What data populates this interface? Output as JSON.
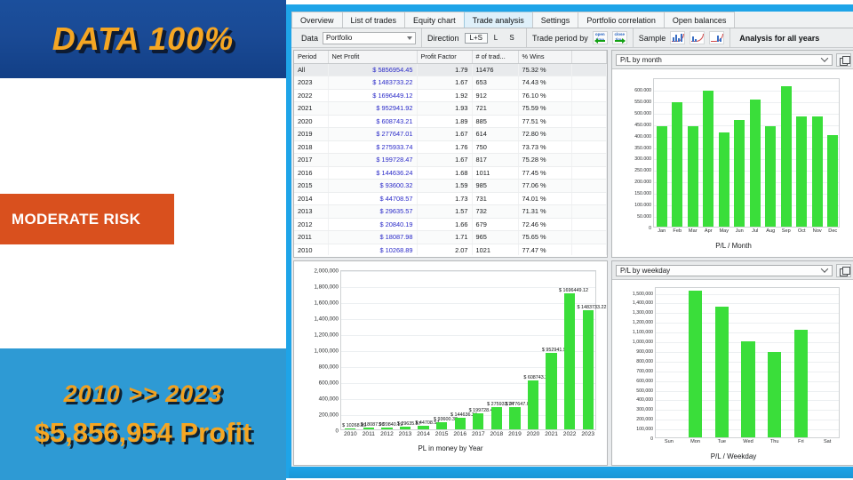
{
  "promo": {
    "headline": "DATA 100%",
    "risk_badge": "MODERATE RISK",
    "years_range": "2010 >> 2023",
    "profit_line": "$5,856,954 Profit",
    "colors": {
      "band_top": "#1b4f9c",
      "band_bottom": "#2e9ad4",
      "accent": "#f5a623",
      "risk": "#d9501e"
    }
  },
  "app": {
    "accent": "#1ea4e8",
    "tabs": [
      {
        "label": "Overview",
        "active": false
      },
      {
        "label": "List of trades",
        "active": false
      },
      {
        "label": "Equity chart",
        "active": false
      },
      {
        "label": "Trade analysis",
        "active": true
      },
      {
        "label": "Settings",
        "active": false
      },
      {
        "label": "Portfolio correlation",
        "active": false
      },
      {
        "label": "Open balances",
        "active": false
      }
    ],
    "toolbar": {
      "data_label": "Data",
      "data_value": "Portfolio",
      "direction_label": "Direction",
      "direction_options": [
        "L+S",
        "L",
        "S"
      ],
      "direction_selected": "L+S",
      "trade_period_label": "Trade period by",
      "trade_period_icons": [
        "open-time",
        "close-time"
      ],
      "open_time_text": "open time",
      "close_time_text": "close time",
      "sample_label": "Sample",
      "sample_icons": [
        "sample-all-icon",
        "sample-in-icon",
        "sample-out-icon"
      ],
      "analysis_title": "Analysis for all years"
    }
  },
  "table": {
    "columns": [
      "Period",
      "Net Profit",
      "Profit Factor",
      "# of trad...",
      "% Wins"
    ],
    "rows": [
      {
        "period": "All",
        "net_profit": "$ 5856954.45",
        "profit_factor": "1.79",
        "trades": "11476",
        "wins": "75.32 %",
        "highlight": true
      },
      {
        "period": "2023",
        "net_profit": "$ 1483733.22",
        "profit_factor": "1.67",
        "trades": "653",
        "wins": "74.43 %"
      },
      {
        "period": "2022",
        "net_profit": "$ 1696449.12",
        "profit_factor": "1.92",
        "trades": "912",
        "wins": "76.10 %"
      },
      {
        "period": "2021",
        "net_profit": "$ 952941.92",
        "profit_factor": "1.93",
        "trades": "721",
        "wins": "75.59 %"
      },
      {
        "period": "2020",
        "net_profit": "$ 608743.21",
        "profit_factor": "1.89",
        "trades": "885",
        "wins": "77.51 %"
      },
      {
        "period": "2019",
        "net_profit": "$ 277647.01",
        "profit_factor": "1.67",
        "trades": "614",
        "wins": "72.80 %"
      },
      {
        "period": "2018",
        "net_profit": "$ 275933.74",
        "profit_factor": "1.76",
        "trades": "750",
        "wins": "73.73 %"
      },
      {
        "period": "2017",
        "net_profit": "$ 199728.47",
        "profit_factor": "1.67",
        "trades": "817",
        "wins": "75.28 %"
      },
      {
        "period": "2016",
        "net_profit": "$ 144636.24",
        "profit_factor": "1.68",
        "trades": "1011",
        "wins": "77.45 %"
      },
      {
        "period": "2015",
        "net_profit": "$ 93600.32",
        "profit_factor": "1.59",
        "trades": "985",
        "wins": "77.06 %"
      },
      {
        "period": "2014",
        "net_profit": "$ 44708.57",
        "profit_factor": "1.73",
        "trades": "731",
        "wins": "74.01 %"
      },
      {
        "period": "2013",
        "net_profit": "$ 29635.57",
        "profit_factor": "1.57",
        "trades": "732",
        "wins": "71.31 %"
      },
      {
        "period": "2012",
        "net_profit": "$ 20840.19",
        "profit_factor": "1.66",
        "trades": "679",
        "wins": "72.46 %"
      },
      {
        "period": "2011",
        "net_profit": "$ 18087.98",
        "profit_factor": "1.71",
        "trades": "965",
        "wins": "75.65 %"
      },
      {
        "period": "2010",
        "net_profit": "$ 10268.89",
        "profit_factor": "2.07",
        "trades": "1021",
        "wins": "77.47 %"
      }
    ]
  },
  "panels": {
    "month_select": "P/L by month",
    "weekday_select": "P/L by weekday",
    "popout_icon": "popout-icon"
  },
  "chart_data": [
    {
      "id": "month",
      "type": "bar",
      "title": "",
      "xlabel": "P/L / Month",
      "ylabel": "",
      "categories": [
        "Jan",
        "Feb",
        "Mar",
        "Apr",
        "May",
        "Jun",
        "Jul",
        "Aug",
        "Sep",
        "Oct",
        "Nov",
        "Dec"
      ],
      "values": [
        438000,
        543000,
        438000,
        592000,
        410000,
        464000,
        553000,
        437000,
        613000,
        479000,
        478000,
        397000
      ],
      "ylim": [
        0,
        650000
      ],
      "yticks": [
        0,
        50000,
        100000,
        150000,
        200000,
        250000,
        300000,
        350000,
        400000,
        450000,
        500000,
        550000,
        600000
      ],
      "ytick_labels": [
        "0",
        "50.000",
        "100.000",
        "150.000",
        "200.000",
        "250.000",
        "300.000",
        "350.000",
        "400.000",
        "450.000",
        "500.000",
        "550.000",
        "600.000"
      ],
      "grid": true,
      "bar_color": "#3ade3a"
    },
    {
      "id": "year",
      "type": "bar",
      "title": "",
      "xlabel": "PL in money by Year",
      "ylabel": "",
      "categories": [
        "2010",
        "2011",
        "2012",
        "2013",
        "2014",
        "2015",
        "2016",
        "2017",
        "2018",
        "2019",
        "2020",
        "2021",
        "2022",
        "2023"
      ],
      "values": [
        10268.89,
        18087.98,
        20840.19,
        29635.57,
        44708.57,
        93600.32,
        144636.24,
        199728.47,
        275933.74,
        277647.01,
        608743.21,
        952941.92,
        1696449.12,
        1483733.22
      ],
      "point_labels": [
        "$ 10268.89",
        "$ 18087.98",
        "$ 20840.19",
        "$ 29635.57",
        "$ 44708.57",
        "$ 93600.32",
        "$ 144636.24",
        "$ 199728.47",
        "$ 275933.74",
        "$ 277647.01",
        "$ 608743.21",
        "$ 952941.92",
        "$ 1696449.12",
        "$ 1483733.22"
      ],
      "ylim": [
        0,
        2000000
      ],
      "yticks": [
        0,
        200000,
        400000,
        600000,
        800000,
        1000000,
        1200000,
        1400000,
        1600000,
        1800000,
        2000000
      ],
      "ytick_labels": [
        "0",
        "200,000",
        "400,000",
        "600,000",
        "800,000",
        "1,000,000",
        "1,200,000",
        "1,400,000",
        "1,600,000",
        "1,800,000",
        "2,000,000"
      ],
      "grid": true,
      "bar_color": "#3ade3a"
    },
    {
      "id": "weekday",
      "type": "bar",
      "title": "",
      "xlabel": "P/L / Weekday",
      "ylabel": "",
      "categories": [
        "Sun",
        "Mon",
        "Tue",
        "Wed",
        "Thu",
        "Fri",
        "Sat"
      ],
      "values": [
        0,
        1513000,
        1351000,
        989000,
        884000,
        1106000,
        0
      ],
      "ylim": [
        0,
        1560000
      ],
      "yticks": [
        0,
        100000,
        200000,
        300000,
        400000,
        500000,
        600000,
        700000,
        800000,
        900000,
        1000000,
        1100000,
        1200000,
        1300000,
        1400000,
        1500000
      ],
      "ytick_labels": [
        "0",
        "100,000",
        "200,000",
        "300,000",
        "400,000",
        "500,000",
        "600,000",
        "700,000",
        "800,000",
        "900,000",
        "1,000,000",
        "1,100,000",
        "1,200,000",
        "1,300,000",
        "1,400,000",
        "1,500,000"
      ],
      "grid": true,
      "bar_color": "#3ade3a"
    }
  ]
}
